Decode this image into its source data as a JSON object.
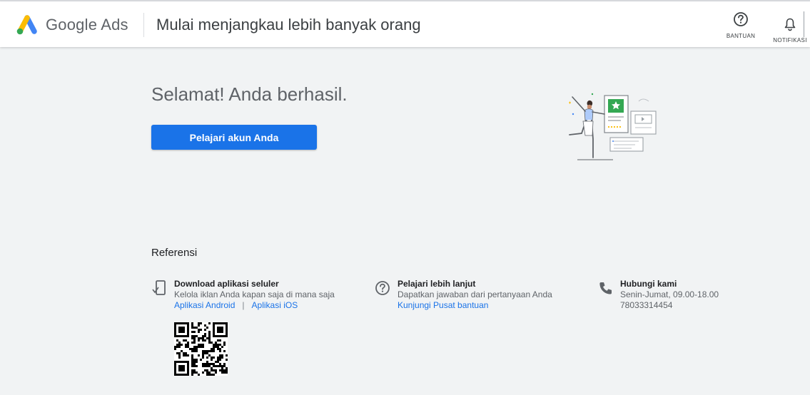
{
  "header": {
    "brand": "Google Ads",
    "title": "Mulai menjangkau lebih banyak orang",
    "help_label": "BANTUAN",
    "notifications_label": "NOTIFIKASI"
  },
  "hero": {
    "title": "Selamat! Anda berhasil.",
    "button_label": "Pelajari akun Anda"
  },
  "references": {
    "title": "Referensi",
    "items": [
      {
        "icon": "mobile-phone-icon",
        "title": "Download aplikasi seluler",
        "description": "Kelola iklan Anda kapan saja di mana saja",
        "links": [
          "Aplikasi Android",
          "Aplikasi iOS"
        ],
        "separator": "|"
      },
      {
        "icon": "help-circle-icon",
        "title": "Pelajari lebih lanjut",
        "description": "Dapatkan jawaban dari pertanyaan Anda",
        "link": "Kunjungi Pusat bantuan"
      },
      {
        "icon": "phone-icon",
        "title": "Hubungi kami",
        "description": "Senin-Jumat, 09.00-18.00",
        "phone": "78033314454"
      }
    ]
  },
  "colors": {
    "accent": "#1a73e8",
    "background": "#f1f3f4",
    "logo_blue": "#4285f4",
    "logo_yellow": "#fbbc04",
    "logo_green": "#34a853"
  }
}
